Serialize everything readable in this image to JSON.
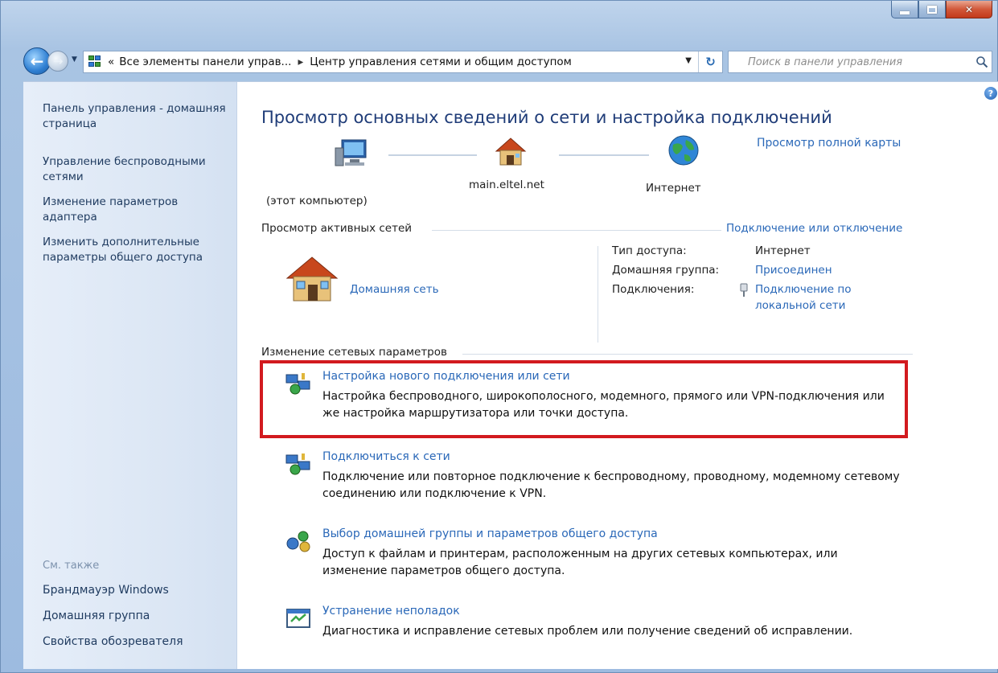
{
  "address": {
    "crumb_prefix": "«",
    "crumb1": "Все элементы панели управ...",
    "crumb_arrow": "▸",
    "crumb2": "Центр управления сетями и общим доступом"
  },
  "search": {
    "placeholder": "Поиск в панели управления"
  },
  "sidebar": {
    "home": "Панель управления - домашняя страница",
    "links": [
      "Управление беспроводными сетями",
      "Изменение параметров адаптера",
      "Изменить дополнительные параметры общего доступа"
    ],
    "see_also": "См. также",
    "footer_links": [
      "Брандмауэр Windows",
      "Домашняя группа",
      "Свойства обозревателя"
    ]
  },
  "main": {
    "title": "Просмотр основных сведений о сети и настройка подключений",
    "full_map_link": "Просмотр полной карты",
    "map": {
      "computer_label": "(этот компьютер)",
      "network_label": "main.eltel.net",
      "internet_label": "Интернет"
    },
    "active_networks": {
      "heading": "Просмотр активных сетей",
      "connect_link": "Подключение или отключение",
      "network_name": "Домашняя сеть",
      "access_type_label": "Тип доступа:",
      "access_type_value": "Интернет",
      "homegroup_label": "Домашняя группа:",
      "homegroup_value": "Присоединен",
      "connections_label": "Подключения:",
      "connections_value_line1": "Подключение по",
      "connections_value_line2": "локальной сети"
    },
    "change_settings": {
      "heading": "Изменение сетевых параметров",
      "tasks": [
        {
          "title": "Настройка нового подключения или сети",
          "desc": "Настройка беспроводного, широкополосного, модемного, прямого или VPN-подключения или же настройка маршрутизатора или точки доступа.",
          "icon": "network-setup-icon"
        },
        {
          "title": "Подключиться к сети",
          "desc": "Подключение или повторное подключение к беспроводному, проводному, модемному сетевому соединению или подключение к VPN.",
          "icon": "connect-network-icon"
        },
        {
          "title": "Выбор домашней группы и параметров общего доступа",
          "desc": "Доступ к файлам и принтерам, расположенным на других сетевых компьютерах, или изменение параметров общего доступа.",
          "icon": "homegroup-icon"
        },
        {
          "title": "Устранение неполадок",
          "desc": "Диагностика и исправление сетевых проблем или получение сведений об исправлении.",
          "icon": "troubleshoot-icon"
        }
      ]
    }
  },
  "colors": {
    "link": "#2a68b8",
    "highlight": "#d21a1f",
    "title": "#1f3c78"
  }
}
